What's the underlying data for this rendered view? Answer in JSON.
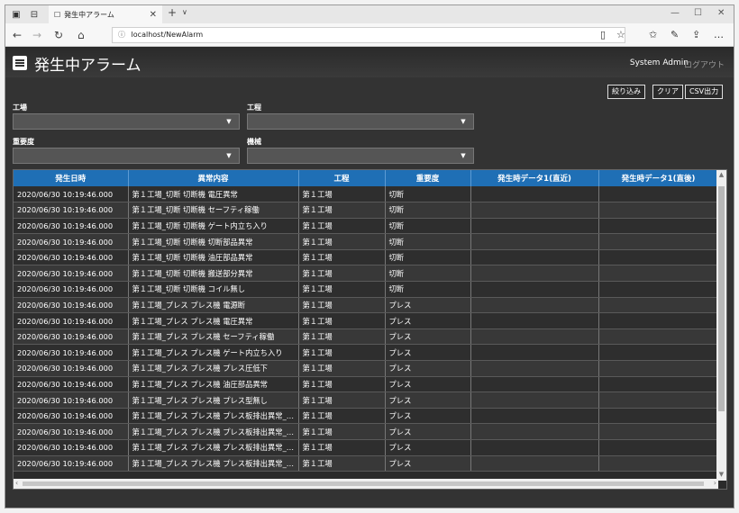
{
  "browser": {
    "tab_title": "発生中アラーム",
    "url": "localhost/NewAlarm"
  },
  "header": {
    "title": "発生中アラーム",
    "user": "System Admin",
    "logout": "ログアウト"
  },
  "toolbar": {
    "filter_label": "絞り込み",
    "clear_label": "クリア",
    "csv_label": "CSV出力"
  },
  "filters": {
    "factory_label": "工場",
    "process_label": "工程",
    "severity_label": "重要度",
    "machine_label": "機械"
  },
  "table": {
    "columns": [
      "発生日時",
      "異常内容",
      "工程",
      "重要度",
      "発生時データ1(直近)",
      "発生時データ1(直後)"
    ],
    "rows": [
      [
        "2020/06/30 10:19:46.000",
        "第１工場_切断 切断機 電圧異常",
        "第１工場",
        "切断",
        "",
        ""
      ],
      [
        "2020/06/30 10:19:46.000",
        "第１工場_切断 切断機 セーフティ稼働",
        "第１工場",
        "切断",
        "",
        ""
      ],
      [
        "2020/06/30 10:19:46.000",
        "第１工場_切断 切断機 ゲート内立ち入り",
        "第１工場",
        "切断",
        "",
        ""
      ],
      [
        "2020/06/30 10:19:46.000",
        "第１工場_切断 切断機 切断部品異常",
        "第１工場",
        "切断",
        "",
        ""
      ],
      [
        "2020/06/30 10:19:46.000",
        "第１工場_切断 切断機 油圧部品異常",
        "第１工場",
        "切断",
        "",
        ""
      ],
      [
        "2020/06/30 10:19:46.000",
        "第１工場_切断 切断機 搬送部分異常",
        "第１工場",
        "切断",
        "",
        ""
      ],
      [
        "2020/06/30 10:19:46.000",
        "第１工場_切断 切断機 コイル無し",
        "第１工場",
        "切断",
        "",
        ""
      ],
      [
        "2020/06/30 10:19:46.000",
        "第１工場_プレス プレス機 電源断",
        "第１工場",
        "プレス",
        "",
        ""
      ],
      [
        "2020/06/30 10:19:46.000",
        "第１工場_プレス プレス機 電圧異常",
        "第１工場",
        "プレス",
        "",
        ""
      ],
      [
        "2020/06/30 10:19:46.000",
        "第１工場_プレス プレス機 セーフティ稼働",
        "第１工場",
        "プレス",
        "",
        ""
      ],
      [
        "2020/06/30 10:19:46.000",
        "第１工場_プレス プレス機 ゲート内立ち入り",
        "第１工場",
        "プレス",
        "",
        ""
      ],
      [
        "2020/06/30 10:19:46.000",
        "第１工場_プレス プレス機 プレス圧低下",
        "第１工場",
        "プレス",
        "",
        ""
      ],
      [
        "2020/06/30 10:19:46.000",
        "第１工場_プレス プレス機 油圧部品異常",
        "第１工場",
        "プレス",
        "",
        ""
      ],
      [
        "2020/06/30 10:19:46.000",
        "第１工場_プレス プレス機 プレス型無し",
        "第１工場",
        "プレス",
        "",
        ""
      ],
      [
        "2020/06/30 10:19:46.000",
        "第１工場_プレス プレス機 プレス板排出異常_…",
        "第１工場",
        "プレス",
        "",
        ""
      ],
      [
        "2020/06/30 10:19:46.000",
        "第１工場_プレス プレス機 プレス板排出異常_…",
        "第１工場",
        "プレス",
        "",
        ""
      ],
      [
        "2020/06/30 10:19:46.000",
        "第１工場_プレス プレス機 プレス板排出異常_…",
        "第１工場",
        "プレス",
        "",
        ""
      ],
      [
        "2020/06/30 10:19:46.000",
        "第１工場_プレス プレス機 プレス板排出異常_…",
        "第１工場",
        "プレス",
        "",
        ""
      ]
    ]
  }
}
